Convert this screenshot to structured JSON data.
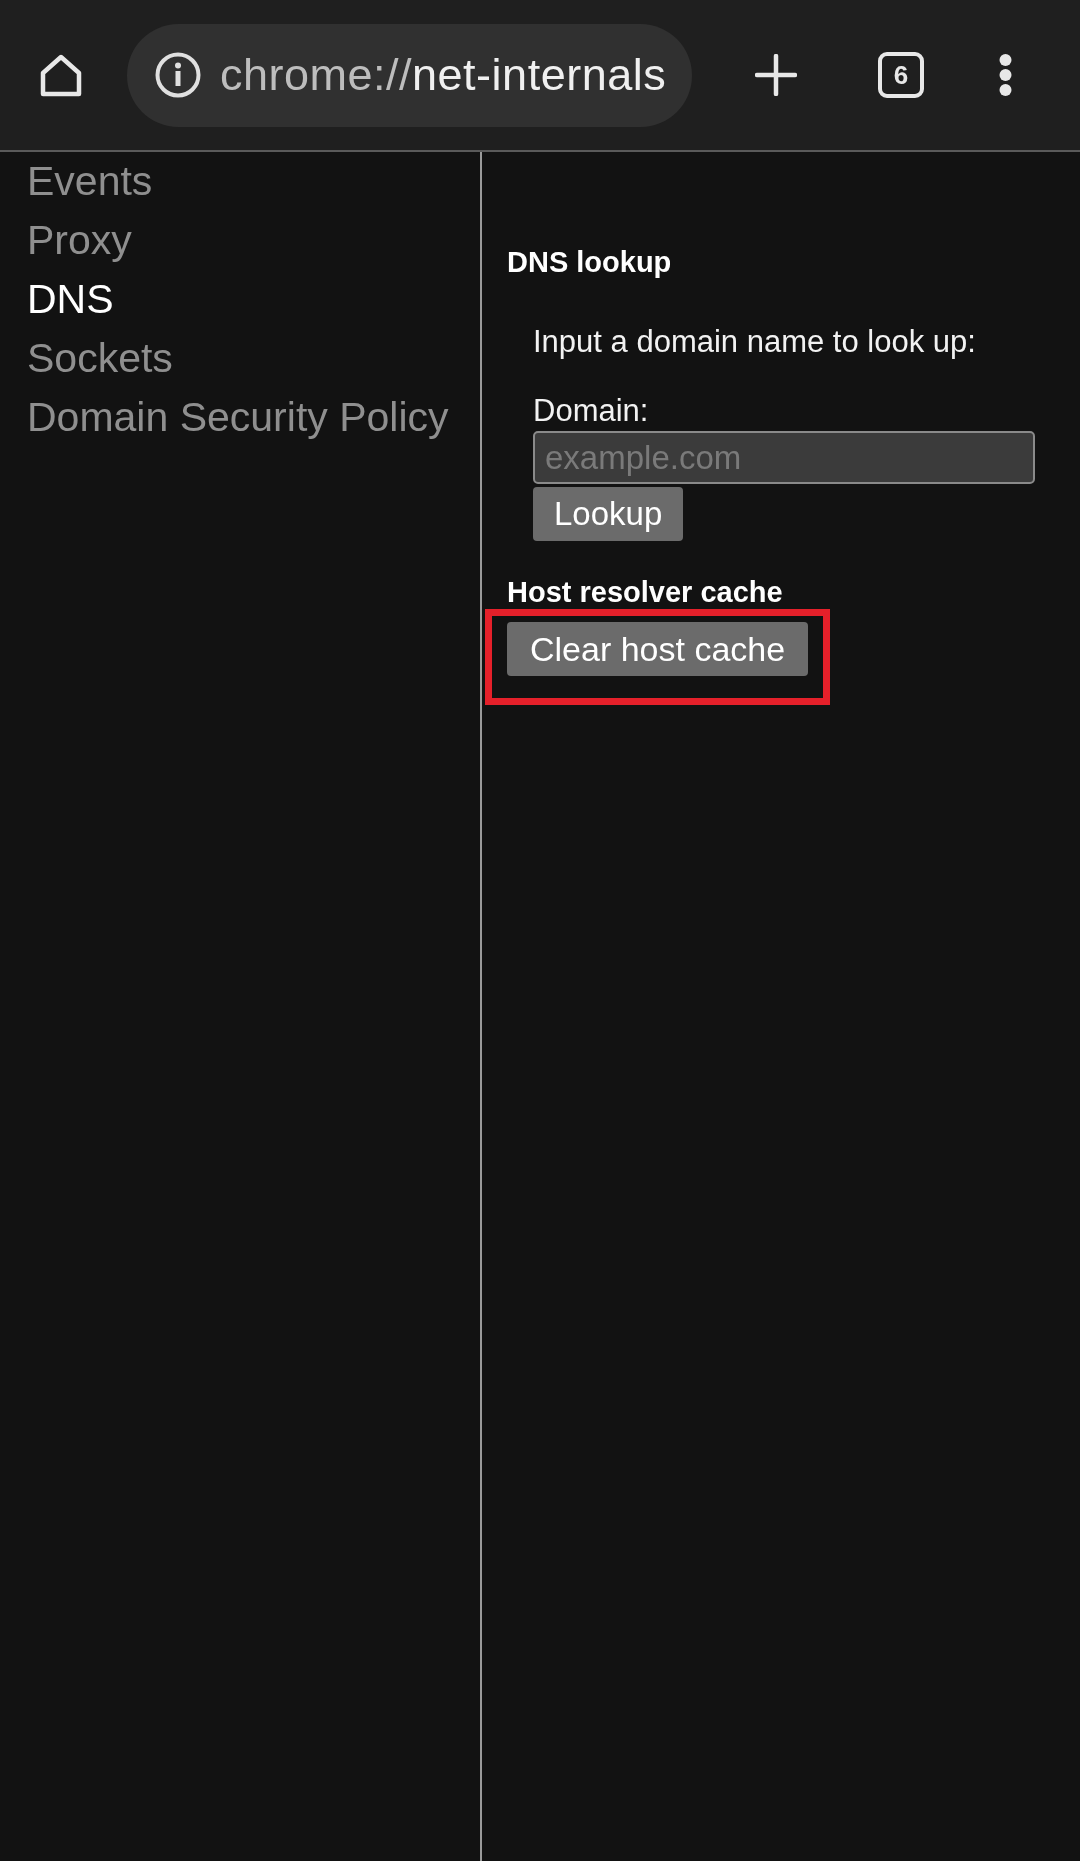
{
  "toolbar": {
    "address_bar": {
      "scheme": "chrome://",
      "path": "net-internals"
    },
    "tab_count": "6"
  },
  "sidebar": {
    "items": [
      {
        "label": "Events",
        "selected": false
      },
      {
        "label": "Proxy",
        "selected": false
      },
      {
        "label": "DNS",
        "selected": true
      },
      {
        "label": "Sockets",
        "selected": false
      },
      {
        "label": "Domain Security Policy",
        "selected": false
      }
    ]
  },
  "dns_lookup": {
    "heading": "DNS lookup",
    "prompt": "Input a domain name to look up:",
    "field_label": "Domain:",
    "domain_field": {
      "placeholder": "example.com"
    },
    "button": "Lookup"
  },
  "host_cache": {
    "heading": "Host resolver cache",
    "button": {
      "label": "Clear host cache",
      "highlighted": true
    }
  }
}
